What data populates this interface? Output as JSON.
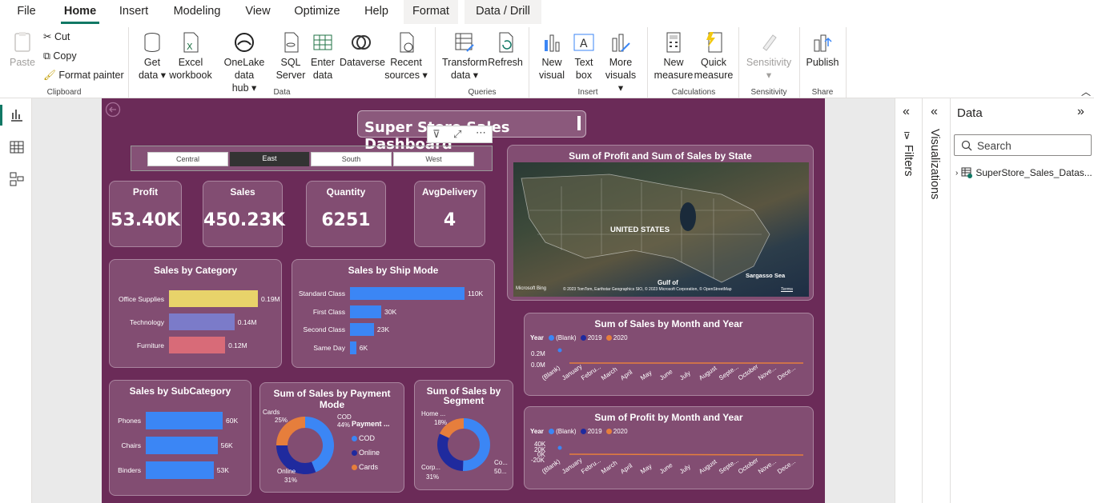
{
  "menu": [
    "File",
    "Home",
    "Insert",
    "Modeling",
    "View",
    "Optimize",
    "Help",
    "Format",
    "Data / Drill"
  ],
  "ribbon": {
    "clipboard": {
      "paste": "Paste",
      "cut": "Cut",
      "copy": "Copy",
      "format_painter": "Format painter",
      "group": "Clipboard"
    },
    "data": {
      "get_data": "Get",
      "get_data2": "data",
      "excel": "Excel",
      "excel2": "workbook",
      "onelake": "OneLake data",
      "onelake2": "hub",
      "sql": "SQL",
      "sql2": "Server",
      "enter": "Enter",
      "enter2": "data",
      "dataverse": "Dataverse",
      "recent": "Recent",
      "recent2": "sources",
      "group": "Data"
    },
    "queries": {
      "transform": "Transform",
      "transform2": "data",
      "refresh": "Refresh",
      "group": "Queries"
    },
    "insert": {
      "new_visual": "New",
      "new_visual2": "visual",
      "text_box": "Text",
      "text_box2": "box",
      "more": "More",
      "more2": "visuals",
      "group": "Insert"
    },
    "calculations": {
      "new_measure": "New",
      "new_measure2": "measure",
      "quick_measure": "Quick",
      "quick_measure2": "measure",
      "group": "Calculations"
    },
    "sensitivity": {
      "label": "Sensitivity",
      "group": "Sensitivity"
    },
    "share": {
      "publish": "Publish",
      "group": "Share"
    }
  },
  "dashboard": {
    "title": "Super Store Sales Dashboard",
    "slicer": [
      "Central",
      "East",
      "South",
      "West"
    ],
    "selected_region": "East",
    "kpis": [
      {
        "label": "Profit",
        "value": "53.40K"
      },
      {
        "label": "Sales",
        "value": "450.23K"
      },
      {
        "label": "Quantity",
        "value": "6251"
      },
      {
        "label": "AvgDelivery",
        "value": "4"
      }
    ],
    "map": {
      "title": "Sum of Profit and Sum of Sales by State",
      "country": "UNITED STATES",
      "sea": "Sargasso Sea",
      "gulf": "Gulf of",
      "mexico": "MEXICO",
      "brand": "Microsoft Bing",
      "credits": "© 2023 TomTom, Earthstar Geographics SIO, © 2023 Microsoft Corporation, © OpenStreetMap",
      "terms": "Terms"
    },
    "category": {
      "title": "Sales by Category",
      "rows": [
        {
          "label": "Office Supplies",
          "value": 0.19,
          "text": "0.19M",
          "color": "#e8d36a"
        },
        {
          "label": "Technology",
          "value": 0.14,
          "text": "0.14M",
          "color": "#7b7bc9"
        },
        {
          "label": "Furniture",
          "value": 0.12,
          "text": "0.12M",
          "color": "#d86b78"
        }
      ]
    },
    "shipmode": {
      "title": "Sales by Ship Mode",
      "rows": [
        {
          "label": "Standard Class",
          "value": 110,
          "text": "110K"
        },
        {
          "label": "First Class",
          "value": 30,
          "text": "30K"
        },
        {
          "label": "Second Class",
          "value": 23,
          "text": "23K"
        },
        {
          "label": "Same Day",
          "value": 6,
          "text": "6K"
        }
      ]
    },
    "subcategory": {
      "title": "Sales by SubCategory",
      "rows": [
        {
          "label": "Phones",
          "value": 60,
          "text": "60K"
        },
        {
          "label": "Chairs",
          "value": 56,
          "text": "56K"
        },
        {
          "label": "Binders",
          "value": 53,
          "text": "53K"
        }
      ]
    },
    "payment": {
      "title": "Sum of Sales by Payment Mode",
      "legend_title": "Payment ...",
      "legend": [
        "COD",
        "Online",
        "Cards"
      ],
      "labels": {
        "cards": "Cards",
        "cards_pct": "25%",
        "cod": "COD",
        "cod_pct": "44%",
        "online": "Online",
        "online_pct": "31%"
      }
    },
    "segment": {
      "title": "Sum of Sales by",
      "title2": "Segment",
      "labels": {
        "home": "Home ...",
        "home_pct": "18%",
        "corp": "Corp...",
        "corp_pct": "31%",
        "co": "Co...",
        "co_pct": "50..."
      }
    },
    "sales_month": {
      "title": "Sum of Sales by Month and Year",
      "y_ticks": [
        "0.2M",
        "0.0M"
      ]
    },
    "profit_month": {
      "title": "Sum of Profit by Month and Year",
      "y_ticks": [
        "40K",
        "20K",
        "0K",
        "-20K"
      ]
    },
    "legend_year": {
      "title": "Year",
      "items": [
        "(Blank)",
        "2019",
        "2020"
      ]
    },
    "months": [
      "(Blank)",
      "January",
      "Febru...",
      "March",
      "April",
      "May",
      "June",
      "July",
      "August",
      "Septe...",
      "October",
      "Nove...",
      "Dece..."
    ]
  },
  "panes": {
    "filters": "Filters",
    "visualizations": "Visualizations",
    "data": "Data",
    "search_placeholder": "Search",
    "table": "SuperStore_Sales_Datas..."
  },
  "colors": {
    "canvas": "#6b2b58",
    "accent": "#117865",
    "bar_blue": "#3b86f5",
    "cod": "#3b86f5",
    "online": "#1f2a9e",
    "cards": "#e67e3c"
  },
  "chart_data": [
    {
      "type": "bar",
      "title": "Sales by Category",
      "categories": [
        "Office Supplies",
        "Technology",
        "Furniture"
      ],
      "values": [
        0.19,
        0.14,
        0.12
      ]
    },
    {
      "type": "bar",
      "title": "Sales by Ship Mode",
      "categories": [
        "Standard Class",
        "First Class",
        "Second Class",
        "Same Day"
      ],
      "values": [
        110,
        30,
        23,
        6
      ]
    },
    {
      "type": "bar",
      "title": "Sales by SubCategory",
      "categories": [
        "Phones",
        "Chairs",
        "Binders"
      ],
      "values": [
        60,
        56,
        53
      ]
    },
    {
      "type": "pie",
      "title": "Sum of Sales by Payment Mode",
      "categories": [
        "COD",
        "Online",
        "Cards"
      ],
      "values": [
        44,
        31,
        25
      ]
    },
    {
      "type": "pie",
      "title": "Sum of Sales by Segment",
      "categories": [
        "Co...",
        "Corp...",
        "Home ..."
      ],
      "values": [
        50,
        31,
        18
      ]
    }
  ]
}
